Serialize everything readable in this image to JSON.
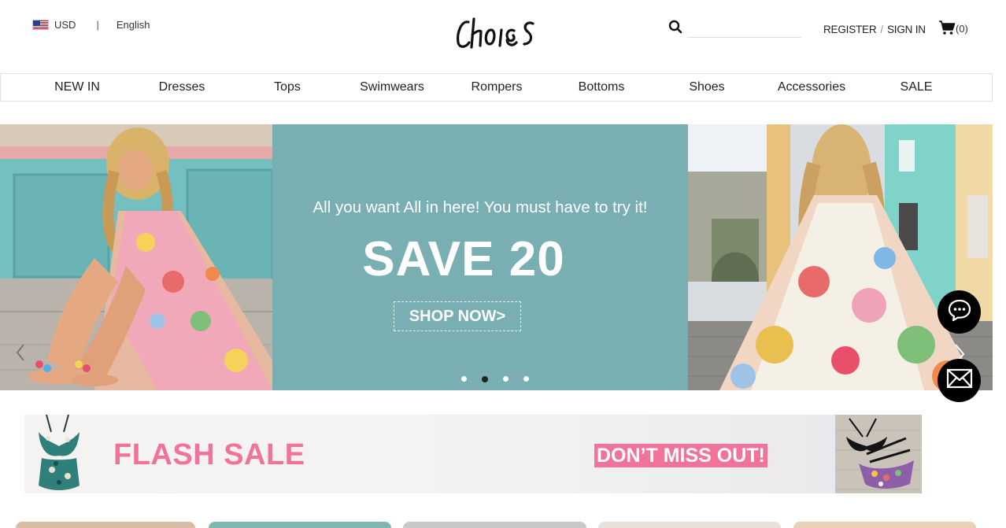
{
  "header": {
    "currency": "USD",
    "separator": "|",
    "language": "English",
    "logo_text": "CHOIES",
    "search_placeholder": "",
    "register_label": "REGISTER",
    "account_separator": "/",
    "signin_label": "SIGN IN",
    "cart_count": "(0)"
  },
  "nav": {
    "items": [
      "NEW IN",
      "Dresses",
      "Tops",
      "Swimwears",
      "Rompers",
      "Bottoms",
      "Shoes",
      "Accessories",
      "SALE"
    ]
  },
  "hero": {
    "tagline": "All you want All in here! You must have to try it!",
    "headline": "SAVE 20",
    "cta": "SHOP NOW>",
    "slide_count": 4,
    "active_slide": 2
  },
  "flash_banner": {
    "title": "FLASH SALE",
    "subtitle": "DON’T MISS OUT!"
  },
  "colors": {
    "hero_panel": "#79afb2",
    "flash_pink": "#f2739a",
    "fab": "#000000"
  },
  "icons": {
    "flag": "us-flag-icon",
    "search": "search-icon",
    "cart": "cart-icon",
    "chat": "chat-icon",
    "mail": "mail-icon"
  }
}
